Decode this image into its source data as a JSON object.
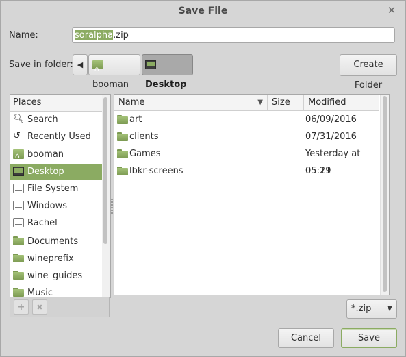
{
  "dialog": {
    "title": "Save File"
  },
  "name_label": "Name:",
  "filename": {
    "selected": "soralpha",
    "rest": ".zip"
  },
  "folder_label": "Save in folder:",
  "path": {
    "back_symbol": "◀",
    "segments": [
      "booman",
      "Desktop"
    ]
  },
  "create_folder_label": "Create Folder",
  "places": {
    "header": "Places",
    "items": [
      {
        "label": "Search",
        "icon": "search-icon"
      },
      {
        "label": "Recently Used",
        "icon": "recent-icon"
      },
      {
        "label": "booman",
        "icon": "home-folder-icon"
      },
      {
        "label": "Desktop",
        "icon": "desktop-icon"
      },
      {
        "label": "File System",
        "icon": "drive-icon"
      },
      {
        "label": "Windows",
        "icon": "drive-icon"
      },
      {
        "label": "Rachel",
        "icon": "drive-icon"
      },
      {
        "label": "Documents",
        "icon": "folder-icon"
      },
      {
        "label": "wineprefix",
        "icon": "folder-icon"
      },
      {
        "label": "wine_guides",
        "icon": "folder-icon"
      },
      {
        "label": "Music",
        "icon": "folder-icon"
      }
    ],
    "add_symbol": "+",
    "remove_symbol": "✖"
  },
  "files": {
    "columns": {
      "name": "Name",
      "size": "Size",
      "modified": "Modified"
    },
    "rows": [
      {
        "name": "art",
        "size": "",
        "modified": "06/09/2016"
      },
      {
        "name": "clients",
        "size": "",
        "modified": "07/31/2016"
      },
      {
        "name": "Games",
        "size": "",
        "modified": "Yesterday at 05:21"
      },
      {
        "name": "lbkr-screens",
        "size": "",
        "modified": "05:19"
      }
    ]
  },
  "filter": {
    "value": "*.zip"
  },
  "actions": {
    "cancel": "Cancel",
    "save": "Save"
  },
  "colors": {
    "accent": "#8bab62",
    "background": "#d6d6d6"
  }
}
